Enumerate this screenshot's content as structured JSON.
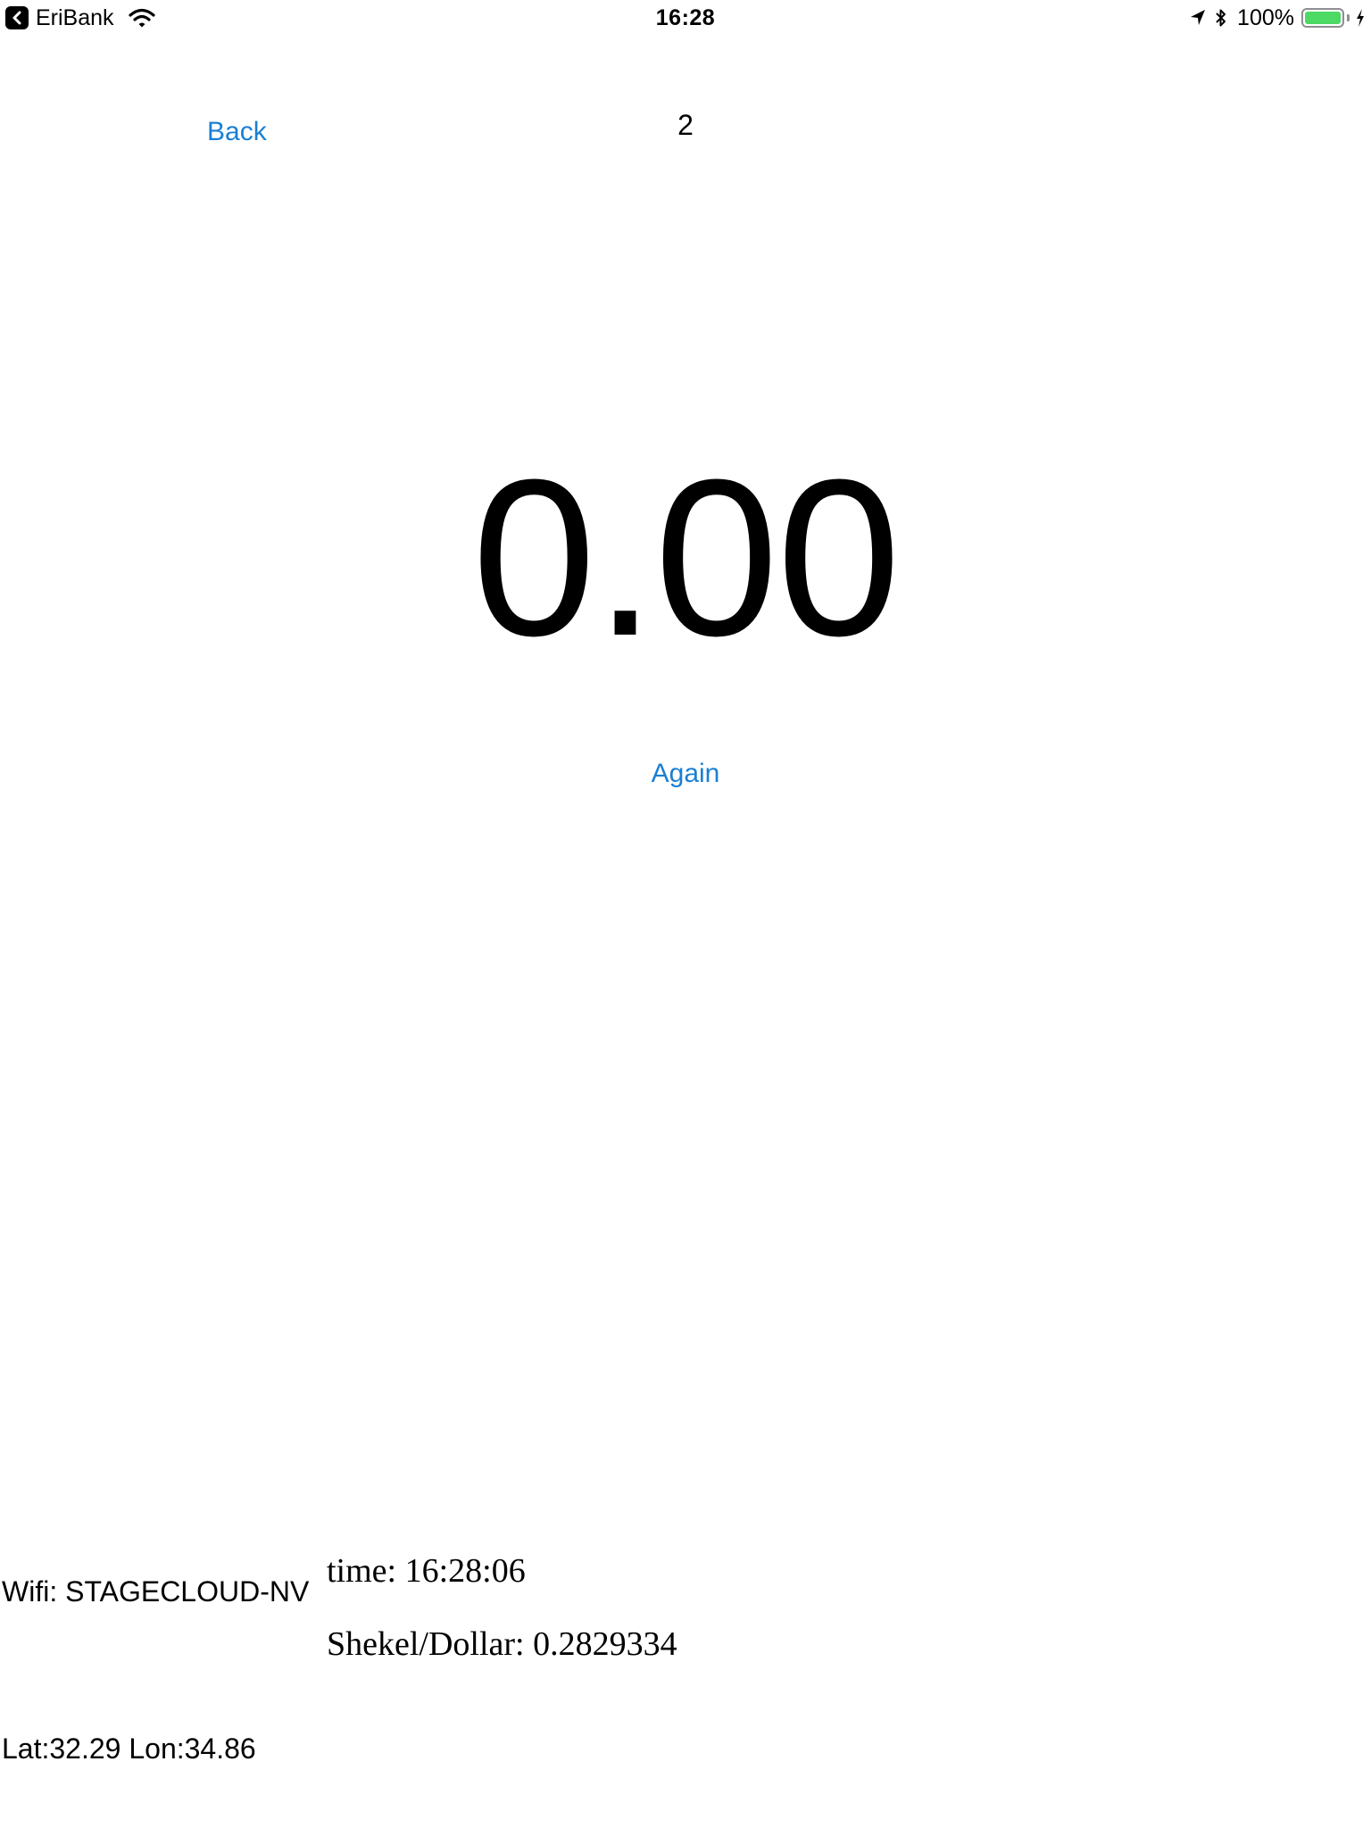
{
  "status_bar": {
    "app_name": "EriBank",
    "time": "16:28",
    "battery_percent": "100%",
    "battery_level": 1.0,
    "battery_color": "#4cd964",
    "icons": [
      "back-to-app-icon",
      "wifi-icon",
      "location-icon",
      "bluetooth-icon",
      "battery-icon",
      "charging-icon"
    ]
  },
  "nav": {
    "back_label": "Back",
    "counter": "2"
  },
  "main": {
    "value": "0.00",
    "again_label": "Again"
  },
  "footer": {
    "wifi": "Wifi: STAGECLOUD-NV",
    "time": "time: 16:28:06",
    "rate": "Shekel/Dollar: 0.2829334",
    "geo": "Lat:32.29 Lon:34.86"
  },
  "colors": {
    "accent": "#1a7fd4",
    "text": "#000000",
    "background": "#ffffff"
  }
}
